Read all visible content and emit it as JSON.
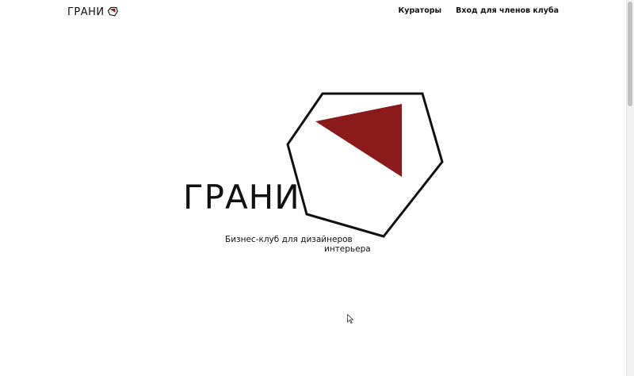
{
  "header": {
    "brand": "ГРАНИ",
    "brand_icon": "grani-logo-icon",
    "nav": [
      {
        "label": "Кураторы"
      },
      {
        "label": "Вход для членов клуба"
      }
    ]
  },
  "hero": {
    "title": "ГРАНИ",
    "tagline_line1": "Бизнес-клуб для дизайнеров",
    "tagline_line2": "интерьера",
    "logo_icon": "heptagon-triangle-logo",
    "accent_color": "#8b1a1a"
  }
}
